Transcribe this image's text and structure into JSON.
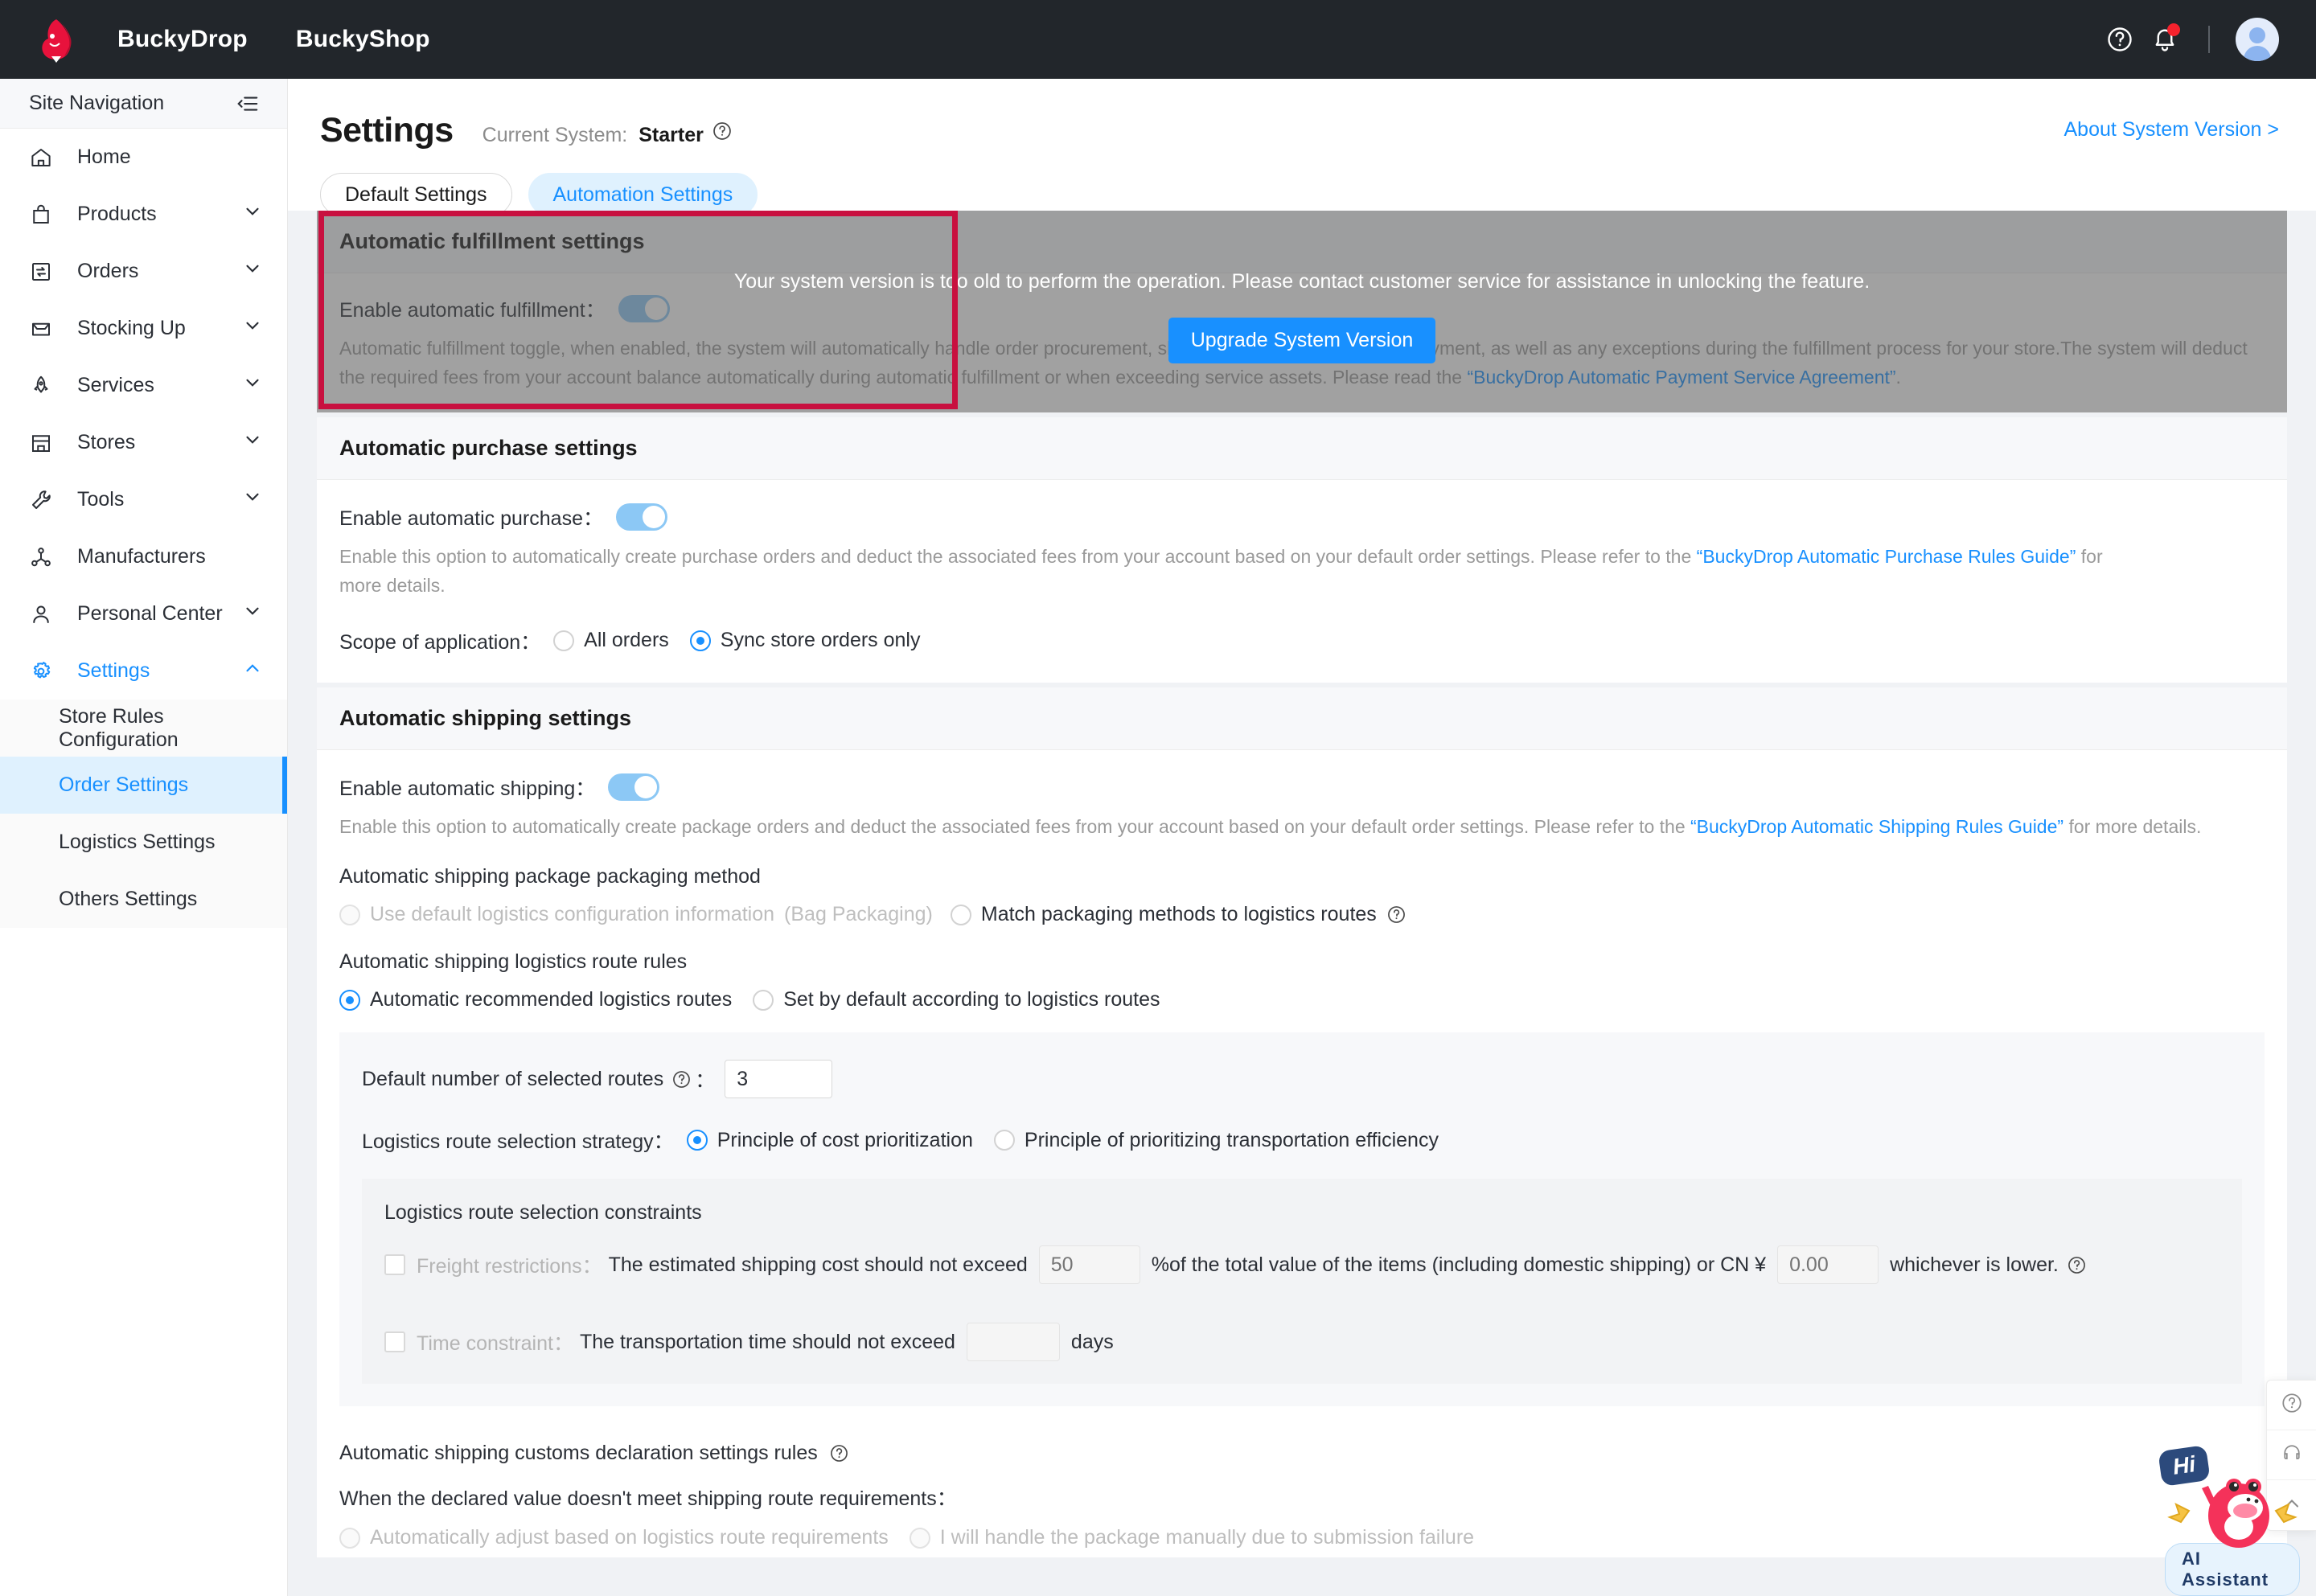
{
  "topbar": {
    "logo_icon": "buckydrop-dino-logo",
    "brand_primary": "BuckyDrop",
    "brand_secondary": "BuckyShop",
    "help_icon": "question-circle-icon",
    "notification_icon": "bell-icon",
    "avatar_icon": "user-avatar-icon"
  },
  "sidebar": {
    "title": "Site Navigation",
    "collapse_icon": "collapse-menu-icon",
    "items": [
      {
        "label": "Home",
        "icon": "home-icon",
        "expandable": false
      },
      {
        "label": "Products",
        "icon": "bag-icon",
        "expandable": true
      },
      {
        "label": "Orders",
        "icon": "orders-exchange-icon",
        "expandable": true
      },
      {
        "label": "Stocking Up",
        "icon": "inbox-icon",
        "expandable": true
      },
      {
        "label": "Services",
        "icon": "rocket-icon",
        "expandable": true
      },
      {
        "label": "Stores",
        "icon": "store-icon",
        "expandable": true
      },
      {
        "label": "Tools",
        "icon": "wrench-icon",
        "expandable": true
      },
      {
        "label": "Manufacturers",
        "icon": "network-nodes-icon",
        "expandable": false
      },
      {
        "label": "Personal Center",
        "icon": "user-icon",
        "expandable": true
      },
      {
        "label": "Settings",
        "icon": "gear-icon",
        "expandable": true,
        "active": true,
        "expanded": true
      }
    ],
    "sub_items": [
      {
        "label": "Store Rules Configuration",
        "active": false
      },
      {
        "label": "Order Settings",
        "active": true
      },
      {
        "label": "Logistics Settings",
        "active": false
      },
      {
        "label": "Others Settings",
        "active": false
      }
    ]
  },
  "page": {
    "title": "Settings",
    "current_system_label": "Current System:",
    "current_system_value": "Starter",
    "current_system_help_icon": "question-circle-icon",
    "about_link": "About System Version >",
    "tabs": [
      {
        "label": "Default Settings",
        "active": false
      },
      {
        "label": "Automation Settings",
        "active": true
      }
    ]
  },
  "fulfillment": {
    "card_title": "Automatic fulfillment settings",
    "toggle_label": "Enable automatic fulfillment：",
    "toggle_state": "on",
    "helper_1": "Automatic fulfillment toggle, when enabled, the system will automatically handle order procurement, shipping, service ordering and payment, as well as any exceptions during the fulfillment process for your store.The system will",
    "helper_2_prefix": "deduct the required fees from your account balance automatically during automatic fulfillment or when exceeding service assets. Please read the ",
    "helper_2_link": "“BuckyDrop Automatic Payment Service Agreement”",
    "helper_2_suffix": ".",
    "mask_message": "Your system version is too old to perform the operation. Please contact customer service for assistance in unlocking the feature.",
    "upgrade_button": "Upgrade System Version",
    "highlight_color": "#c8103f"
  },
  "purchase": {
    "card_title": "Automatic purchase settings",
    "toggle_label": "Enable automatic purchase：",
    "toggle_state": "on",
    "helper_prefix": "Enable this option to automatically create purchase orders and deduct the associated fees from your account based on your default order settings. Please refer to the ",
    "helper_link": "“BuckyDrop Automatic Purchase Rules Guide”",
    "helper_suffix": " for more details.",
    "scope_label": "Scope of application：",
    "scope_options": [
      {
        "label": "All orders",
        "checked": false
      },
      {
        "label": "Sync store orders only",
        "checked": true
      }
    ]
  },
  "shipping": {
    "card_title": "Automatic shipping settings",
    "toggle_label": "Enable automatic shipping：",
    "toggle_state": "on",
    "helper_prefix": "Enable this option to automatically create package orders and deduct the associated fees from your account based on your default order settings. Please refer to the ",
    "helper_link": "“BuckyDrop Automatic Shipping Rules Guide”",
    "helper_suffix": " for more details.",
    "packaging_method_label": "Automatic shipping package packaging method",
    "packaging_options": [
      {
        "label": "Use default logistics configuration information",
        "note": "(Bag Packaging)",
        "checked": false,
        "disabled": true
      },
      {
        "label": "Match packaging methods to logistics routes",
        "help_icon": "question-circle-icon",
        "checked": false,
        "disabled": false
      }
    ],
    "route_rules_label": "Automatic shipping logistics route rules",
    "route_rule_options": [
      {
        "label": "Automatic recommended logistics routes",
        "checked": true
      },
      {
        "label": "Set by default according to logistics routes",
        "checked": false
      }
    ],
    "default_routes_label": "Default number of selected routes",
    "default_routes_help_icon": "question-circle-icon",
    "default_routes_value": "3",
    "strategy_label": "Logistics route selection strategy：",
    "strategy_options": [
      {
        "label": "Principle of cost prioritization",
        "checked": true
      },
      {
        "label": "Principle of prioritizing transportation efficiency",
        "checked": false
      }
    ],
    "constraints_title": "Logistics route selection constraints",
    "freight": {
      "checked": false,
      "label": "Freight restrictions：",
      "text_1": "The estimated shipping cost should not exceed",
      "percent_placeholder": "50",
      "percent_value": "",
      "text_2": "%of the total value of the items (including domestic shipping) or CN ¥",
      "amount_placeholder": "0.00",
      "amount_value": "",
      "text_3": "whichever is lower.",
      "help_icon": "question-circle-icon"
    },
    "time_constraint": {
      "checked": false,
      "label": "Time constraint：",
      "text_1": "The transportation time should not exceed",
      "days_value": "",
      "text_2": "days"
    },
    "customs_title": "Automatic shipping customs declaration settings rules",
    "customs_help_icon": "question-circle-icon",
    "customs_question": "When the declared value doesn't meet shipping route requirements：",
    "customs_options": [
      {
        "label": "Automatically adjust based on logistics route requirements",
        "checked": false,
        "disabled": true
      },
      {
        "label": "I will handle the package manually due to submission failure",
        "checked": false,
        "disabled": true
      }
    ]
  },
  "dock": {
    "buttons": [
      {
        "icon": "question-circle-icon",
        "name": "help-dock-button"
      },
      {
        "icon": "headset-icon",
        "name": "support-dock-button"
      },
      {
        "icon": "chevron-up-icon",
        "name": "scroll-top-dock-button"
      }
    ]
  },
  "ai_assistant": {
    "bubble_text": "Hi",
    "label": "AI Assistant",
    "icon": "ai-assistant-mascot-icon"
  },
  "colors": {
    "accent": "#1890ff",
    "topbar_bg": "#22262b",
    "highlight": "#c8103f",
    "toggle_on": "#8cc8f5"
  }
}
